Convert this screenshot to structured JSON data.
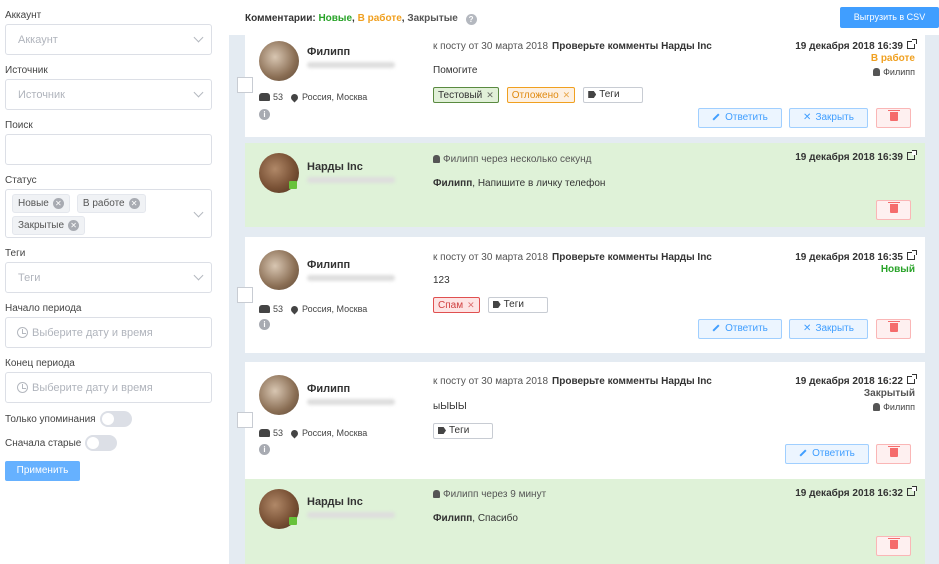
{
  "sidebar": {
    "account": {
      "label": "Аккаунт",
      "placeholder": "Аккаунт"
    },
    "source": {
      "label": "Источник",
      "placeholder": "Источник"
    },
    "search": {
      "label": "Поиск",
      "value": ""
    },
    "status": {
      "label": "Статус",
      "chips": [
        "Новые",
        "В работе",
        "Закрытые"
      ]
    },
    "tags": {
      "label": "Теги",
      "placeholder": "Теги"
    },
    "period_start": {
      "label": "Начало периода",
      "placeholder": "Выберите дату и время"
    },
    "period_end": {
      "label": "Конец периода",
      "placeholder": "Выберите дату и время"
    },
    "mentions_only": {
      "label": "Только упоминания",
      "on": false
    },
    "oldest_first": {
      "label": "Сначала старые",
      "on": false
    },
    "apply_label": "Применить"
  },
  "header": {
    "title_prefix": "Комментарии:",
    "status_new": "Новые",
    "status_work": "В работе",
    "status_closed": "Закрытые",
    "sep": ",",
    "help": "?",
    "export_label": "Выгрузить в CSV"
  },
  "comments": [
    {
      "author": "Филипп",
      "followers": "53",
      "location": "Россия, Москва",
      "meta_prefix": "к посту от 30 марта 2018",
      "post_title": "Проверьте комменты Нарды Inc",
      "date": "19 декабря 2018 16:39",
      "status": "В работе",
      "status_color": "#f0a020",
      "assignee": "Филипп",
      "text": "Помогите",
      "tags": [
        {
          "label": "Тестовый",
          "kind": "test"
        },
        {
          "label": "Отложено",
          "kind": "later"
        }
      ],
      "tags_add": "Теги",
      "reply_label": "Ответить",
      "close_label": "Закрыть"
    },
    {
      "author": "Нарды Inc",
      "who": "Филипп через несколько секунд",
      "date": "19 декабря 2018 16:39",
      "text_bold": "Филипп",
      "text_rest": ", Напишите в личку телефон"
    },
    {
      "author": "Филипп",
      "followers": "53",
      "location": "Россия, Москва",
      "meta_prefix": "к посту от 30 марта 2018",
      "post_title": "Проверьте комменты Нарды Inc",
      "date": "19 декабря 2018 16:35",
      "status": "Новый",
      "status_color": "#29a329",
      "text": "123",
      "tags": [
        {
          "label": "Спам",
          "kind": "spam"
        }
      ],
      "tags_add": "Теги",
      "reply_label": "Ответить",
      "close_label": "Закрыть"
    },
    {
      "author": "Филипп",
      "followers": "53",
      "location": "Россия, Москва",
      "meta_prefix": "к посту от 30 марта 2018",
      "post_title": "Проверьте комменты Нарды Inc",
      "date": "19 декабря 2018 16:22",
      "status": "Закрытый",
      "status_color": "#555555",
      "assignee": "Филипп",
      "text": "ыЫЫЫ",
      "tags_add": "Теги",
      "reply_label": "Ответить"
    },
    {
      "author": "Нарды Inc",
      "who": "Филипп через 9 минут",
      "date": "19 декабря 2018 16:32",
      "text_bold": "Филипп",
      "text_rest": ", Спасибо"
    }
  ],
  "icons": [
    "chevron-down-icon",
    "clock-icon",
    "close-icon",
    "help-icon",
    "group-icon",
    "location-pin-icon",
    "info-icon",
    "external-link-icon",
    "user-icon",
    "tag-icon",
    "pencil-icon",
    "trash-icon"
  ]
}
